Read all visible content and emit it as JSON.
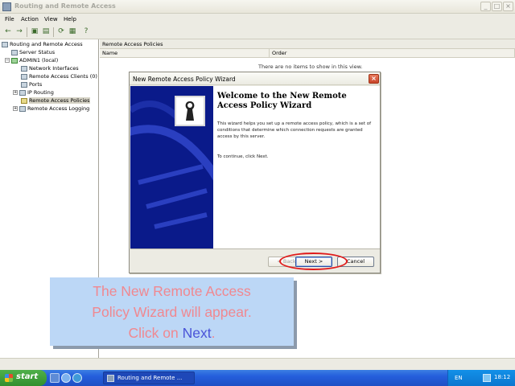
{
  "window": {
    "title": "Routing and Remote Access",
    "min_glyph": "_",
    "max_glyph": "□",
    "close_glyph": "×"
  },
  "menu": [
    "File",
    "Action",
    "View",
    "Help"
  ],
  "toolbar": {
    "buttons": [
      "back-icon",
      "forward-icon",
      "folder-icon",
      "properties-icon",
      "refresh-icon",
      "export-icon",
      "help-icon"
    ],
    "glyphs": [
      "←",
      "→",
      "▣",
      "▤",
      "⟳",
      "▦",
      "?"
    ]
  },
  "tree": {
    "items": [
      {
        "label": "Routing and Remote Access",
        "icon": "rras-icon",
        "level": 0
      },
      {
        "label": "Server Status",
        "icon": "server-status-icon",
        "level": 1
      },
      {
        "label": "ADMIN1 (local)",
        "icon": "server-icon",
        "level": 1,
        "expander": "−"
      },
      {
        "label": "Network Interfaces",
        "icon": "network-interfaces-icon",
        "level": 2
      },
      {
        "label": "Remote Access Clients (0)",
        "icon": "clients-icon",
        "level": 2
      },
      {
        "label": "Ports",
        "icon": "ports-icon",
        "level": 2
      },
      {
        "label": "IP Routing",
        "icon": "ip-routing-icon",
        "level": 2,
        "expander": "+"
      },
      {
        "label": "Remote Access Policies",
        "icon": "policies-icon",
        "level": 2,
        "selected": true
      },
      {
        "label": "Remote Access Logging",
        "icon": "logging-icon",
        "level": 2,
        "expander": "+"
      }
    ]
  },
  "right_pane": {
    "header": "Remote Access Policies",
    "columns": [
      "Name",
      "Order"
    ],
    "empty_message": "There are no items to show in this view."
  },
  "wizard": {
    "title": "New Remote Access Policy Wizard",
    "close_glyph": "×",
    "heading": "Welcome to the New Remote Access Policy Wizard",
    "description": "This wizard helps you set up a remote access policy, which is a set of conditions that determine which connection requests are granted access by this server.",
    "continue_text": "To continue, click Next.",
    "back_label": "< Back",
    "next_label": "Next >",
    "cancel_label": "Cancel"
  },
  "caption": {
    "line1": "The New Remote Access",
    "line2": "Policy Wizard will appear.",
    "line3_prefix": "Click on ",
    "line3_highlight": "Next",
    "line3_suffix": "."
  },
  "taskbar": {
    "start_label": "start",
    "task_label": "Routing and Remote ...",
    "language": "EN",
    "clock": "18:12"
  },
  "colors": {
    "taskbar_blue": "#245edc",
    "start_green": "#328f2e",
    "wizard_banner": "#0a1a8a",
    "highlight_ring": "#e01b1b",
    "caption_bg": "#bcd7f6",
    "caption_text": "#f08890",
    "caption_accent": "#4a54d8"
  }
}
